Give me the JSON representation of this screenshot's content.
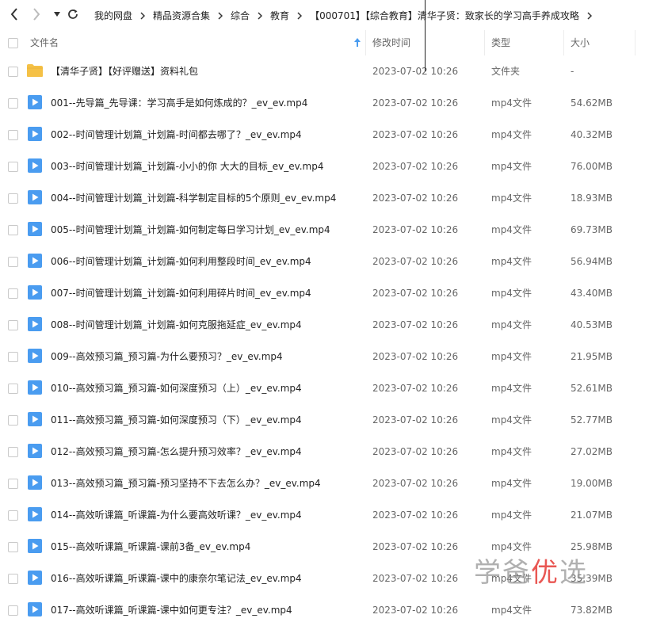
{
  "breadcrumb": [
    "我的网盘",
    "精品资源合集",
    "综合",
    "教育",
    "【000701】【综合教育】清华子贤：致家长的学习高手养成攻略"
  ],
  "columns": {
    "name": "文件名",
    "modified": "修改时间",
    "type": "类型",
    "size": "大小"
  },
  "colors": {
    "folder": "#f5c146",
    "video": "#4a9cf0",
    "watermark_red": "#e53935"
  },
  "files": [
    {
      "name": "【清华子贤】【好评赠送】资料礼包",
      "date": "2023-07-02 10:26",
      "type": "文件夹",
      "size": "-",
      "icon": "folder-icon"
    },
    {
      "name": "001--先导篇_先导课：学习高手是如何炼成的？_ev_ev.mp4",
      "date": "2023-07-02 10:26",
      "type": "mp4文件",
      "size": "54.62MB",
      "icon": "video-file-icon"
    },
    {
      "name": "002--时间管理计划篇_计划篇-时间都去哪了？_ev_ev.mp4",
      "date": "2023-07-02 10:26",
      "type": "mp4文件",
      "size": "40.32MB",
      "icon": "video-file-icon"
    },
    {
      "name": "003--时间管理计划篇_计划篇-小小的你 大大的目标_ev_ev.mp4",
      "date": "2023-07-02 10:26",
      "type": "mp4文件",
      "size": "76.00MB",
      "icon": "video-file-icon"
    },
    {
      "name": "004--时间管理计划篇_计划篇-科学制定目标的5个原则_ev_ev.mp4",
      "date": "2023-07-02 10:26",
      "type": "mp4文件",
      "size": "18.93MB",
      "icon": "video-file-icon"
    },
    {
      "name": "005--时间管理计划篇_计划篇-如何制定每日学习计划_ev_ev.mp4",
      "date": "2023-07-02 10:26",
      "type": "mp4文件",
      "size": "69.73MB",
      "icon": "video-file-icon"
    },
    {
      "name": "006--时间管理计划篇_计划篇-如何利用整段时间_ev_ev.mp4",
      "date": "2023-07-02 10:26",
      "type": "mp4文件",
      "size": "56.94MB",
      "icon": "video-file-icon"
    },
    {
      "name": "007--时间管理计划篇_计划篇-如何利用碎片时间_ev_ev.mp4",
      "date": "2023-07-02 10:26",
      "type": "mp4文件",
      "size": "43.40MB",
      "icon": "video-file-icon"
    },
    {
      "name": "008--时间管理计划篇_计划篇-如何克服拖延症_ev_ev.mp4",
      "date": "2023-07-02 10:26",
      "type": "mp4文件",
      "size": "40.53MB",
      "icon": "video-file-icon"
    },
    {
      "name": "009--高效预习篇_预习篇-为什么要预习？_ev_ev.mp4",
      "date": "2023-07-02 10:26",
      "type": "mp4文件",
      "size": "21.95MB",
      "icon": "video-file-icon"
    },
    {
      "name": "010--高效预习篇_预习篇-如何深度预习（上）_ev_ev.mp4",
      "date": "2023-07-02 10:26",
      "type": "mp4文件",
      "size": "52.61MB",
      "icon": "video-file-icon"
    },
    {
      "name": "011--高效预习篇_预习篇-如何深度预习（下）_ev_ev.mp4",
      "date": "2023-07-02 10:26",
      "type": "mp4文件",
      "size": "52.77MB",
      "icon": "video-file-icon"
    },
    {
      "name": "012--高效预习篇_预习篇-怎么提升预习效率？_ev_ev.mp4",
      "date": "2023-07-02 10:26",
      "type": "mp4文件",
      "size": "27.02MB",
      "icon": "video-file-icon"
    },
    {
      "name": "013--高效预习篇_预习篇-预习坚持不下去怎么办？_ev_ev.mp4",
      "date": "2023-07-02 10:26",
      "type": "mp4文件",
      "size": "19.00MB",
      "icon": "video-file-icon"
    },
    {
      "name": "014--高效听课篇_听课篇-为什么要高效听课？_ev_ev.mp4",
      "date": "2023-07-02 10:26",
      "type": "mp4文件",
      "size": "21.07MB",
      "icon": "video-file-icon"
    },
    {
      "name": "015--高效听课篇_听课篇-课前3备_ev_ev.mp4",
      "date": "2023-07-02 10:26",
      "type": "mp4文件",
      "size": "25.98MB",
      "icon": "video-file-icon"
    },
    {
      "name": "016--高效听课篇_听课篇-课中的康奈尔笔记法_ev_ev.mp4",
      "date": "2023-07-02 10:26",
      "type": "mp4文件",
      "size": "35.39MB",
      "icon": "video-file-icon"
    },
    {
      "name": "017--高效听课篇_听课篇-课中如何更专注？_ev_ev.mp4",
      "date": "2023-07-02 10:26",
      "type": "mp4文件",
      "size": "73.82MB",
      "icon": "video-file-icon"
    }
  ],
  "watermark": {
    "part1": "学爸",
    "part2": "优",
    "part3": "选"
  }
}
